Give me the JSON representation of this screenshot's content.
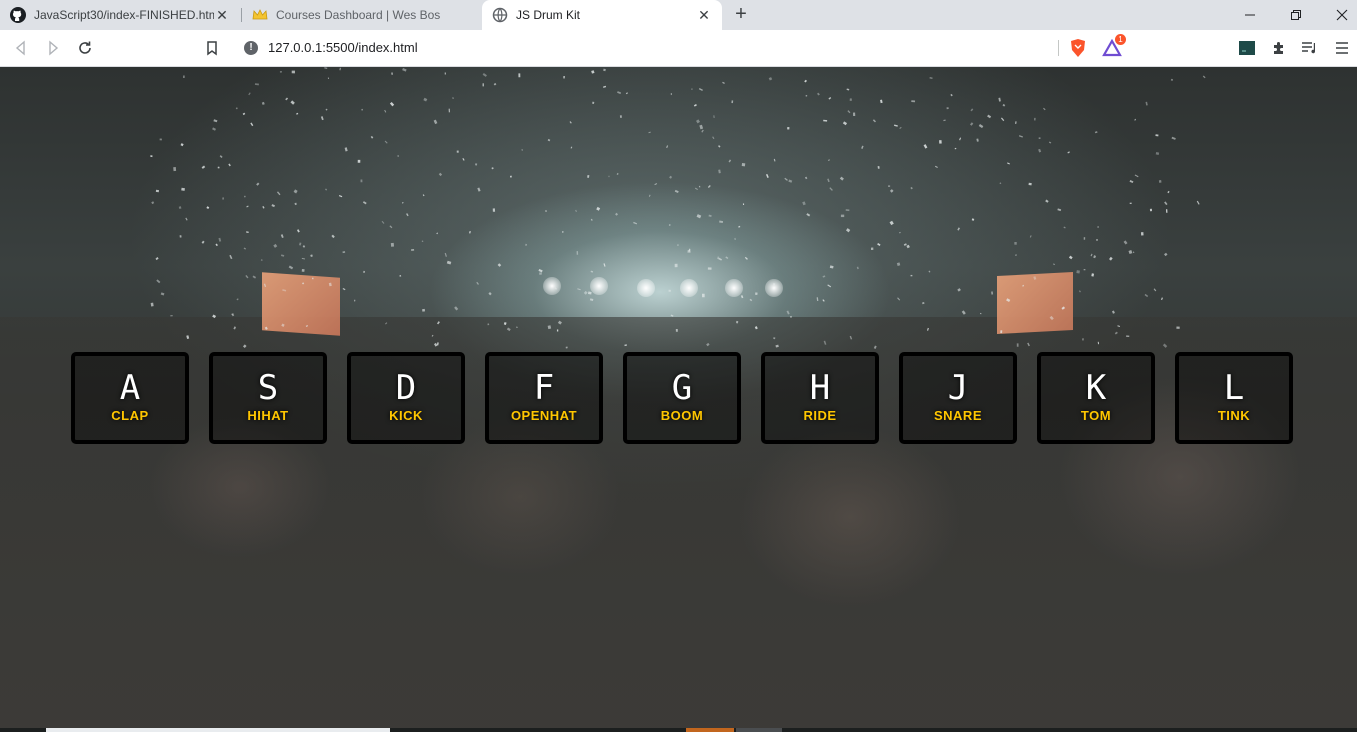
{
  "browser": {
    "tabs": [
      {
        "title": "JavaScript30/index-FINISHED.html",
        "icon": "github-icon",
        "active": false
      },
      {
        "title": "Courses Dashboard | Wes Bos",
        "icon": "crown-icon",
        "active": false
      },
      {
        "title": "JS Drum Kit",
        "icon": "globe-icon",
        "active": true
      }
    ],
    "new_tab": "+",
    "address": {
      "url": "127.0.0.1:5500/index.html"
    },
    "extensions": [
      "brave-shield-icon",
      "brave-rewards-icon",
      "screen-icon",
      "puzzle-icon",
      "media-queue-icon",
      "menu-icon"
    ],
    "rewards_badge": "1"
  },
  "page": {
    "keys": [
      {
        "key": "A",
        "sound": "clap"
      },
      {
        "key": "S",
        "sound": "hihat"
      },
      {
        "key": "D",
        "sound": "kick"
      },
      {
        "key": "F",
        "sound": "openhat"
      },
      {
        "key": "G",
        "sound": "boom"
      },
      {
        "key": "H",
        "sound": "ride"
      },
      {
        "key": "J",
        "sound": "snare"
      },
      {
        "key": "K",
        "sound": "tom"
      },
      {
        "key": "L",
        "sound": "tink"
      }
    ]
  },
  "colors": {
    "accent": "#ffc600",
    "key_border": "#000000",
    "key_text": "#ffffff"
  }
}
